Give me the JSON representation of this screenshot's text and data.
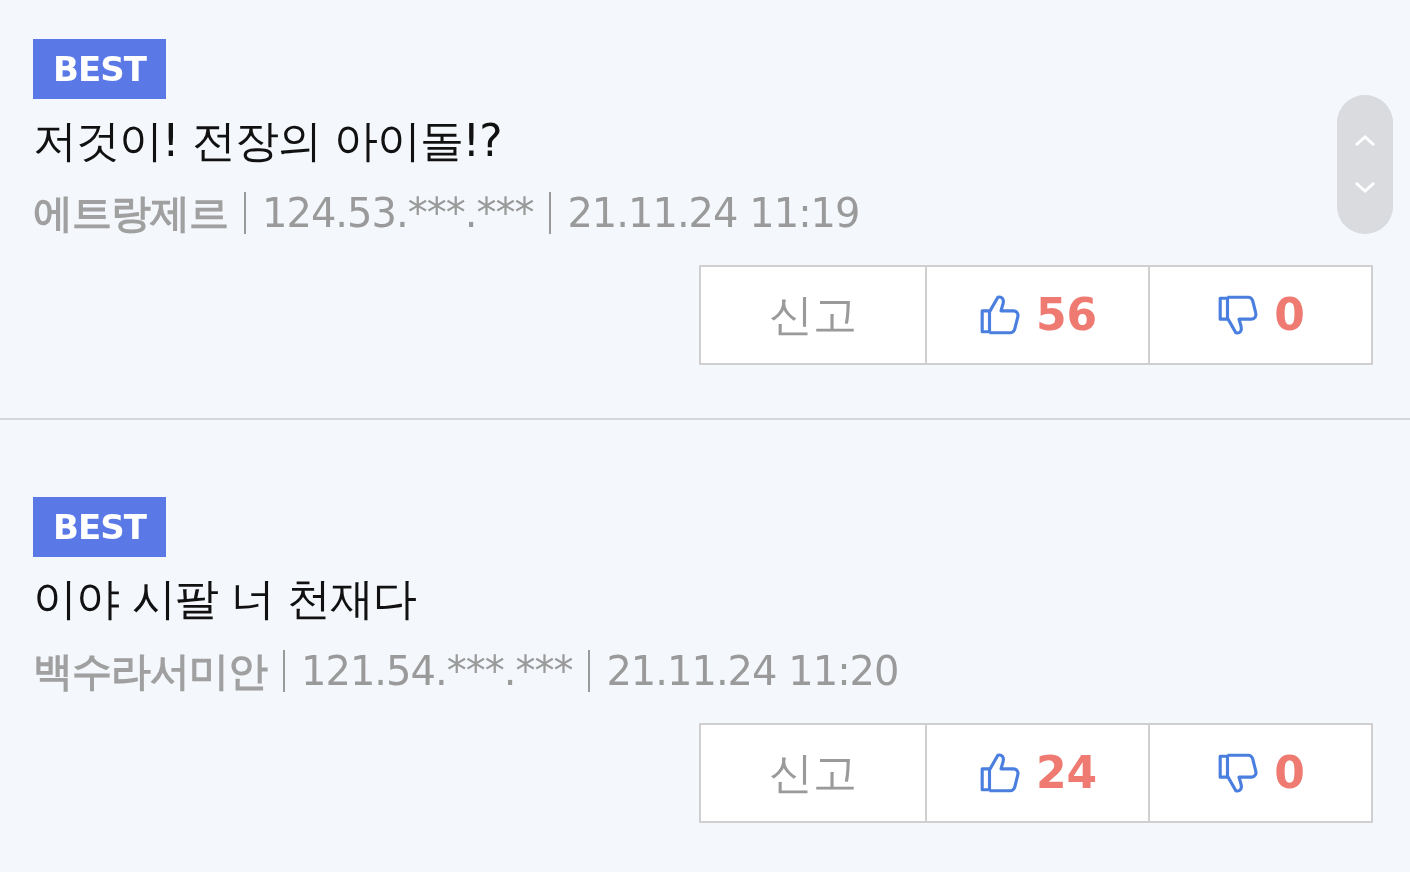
{
  "comments": [
    {
      "badge": "BEST",
      "title": "저것이! 전장의 아이돌!?",
      "author": "에트랑제르",
      "ip": "124.53.***.***",
      "date": "21.11.24 11:19",
      "report_label": "신고",
      "likes": "56",
      "dislikes": "0"
    },
    {
      "badge": "BEST",
      "title": "이야 시팔 너 천재다",
      "author": "백수라서미안",
      "ip": "121.54.***.***",
      "date": "21.11.24 11:20",
      "report_label": "신고",
      "likes": "24",
      "dislikes": "0"
    }
  ]
}
